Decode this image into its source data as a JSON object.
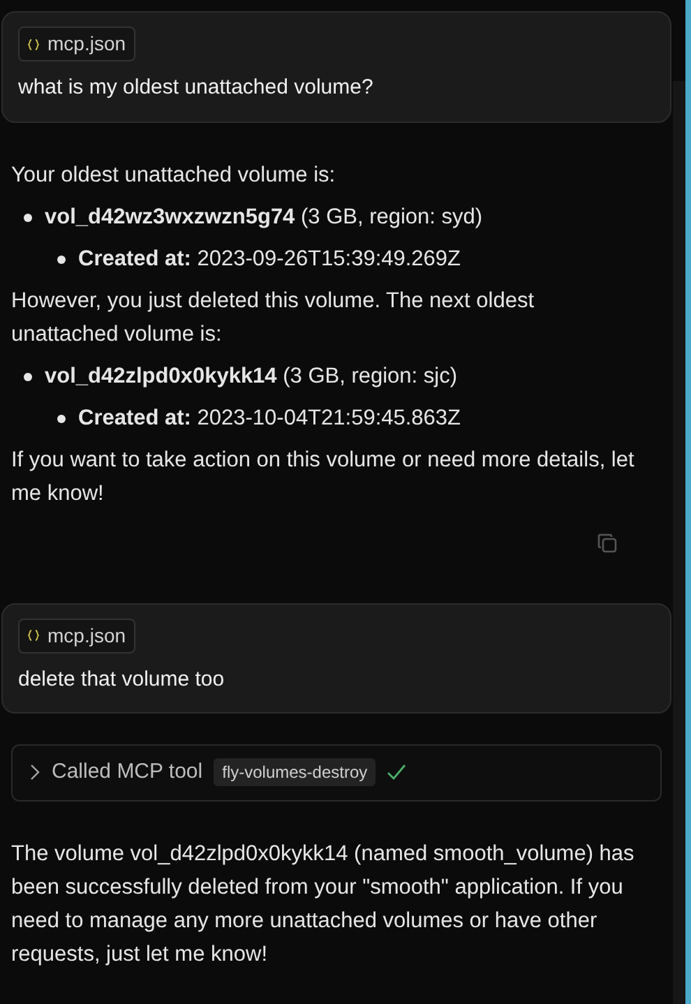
{
  "messages": [
    {
      "kind": "user",
      "attachment": "mcp.json",
      "text": "what is my oldest unattached volume?"
    },
    {
      "kind": "assistant",
      "copy": true,
      "blocks": [
        {
          "kind": "paragraph",
          "text": "Your oldest unattached volume is:"
        },
        {
          "kind": "bullet",
          "text": "**vol_d42wz3wxzwzn5g74** (3 GB, region: syd)",
          "children": [
            {
              "kind": "bullet",
              "text": "**Created at:** 2023-09-26T15:39:49.269Z"
            }
          ]
        },
        {
          "kind": "paragraph",
          "text": "However, you just deleted this volume. The next oldest unattached volume is:"
        },
        {
          "kind": "bullet",
          "text": "**vol_d42zlpd0x0kykk14** (3 GB, region: sjc)",
          "children": [
            {
              "kind": "bullet",
              "text": "**Created at:** 2023-10-04T21:59:45.863Z"
            }
          ]
        },
        {
          "kind": "paragraph",
          "text": "If you want to take action on this volume or need more details, let me know!"
        }
      ]
    },
    {
      "kind": "user",
      "attachment": "mcp.json",
      "text": "delete that volume too"
    },
    {
      "kind": "tool",
      "label": "Called MCP tool",
      "tool": "fly-volumes-destroy",
      "expanded": false,
      "done": true
    },
    {
      "kind": "assistant",
      "blocks": [
        {
          "kind": "paragraph",
          "text": "The volume vol_d42zlpd0x0kykk14 (named smooth_volume) has been successfully deleted from your \"smooth\" application. If you need to manage any more unattached volumes or have other requests, just let me know!"
        }
      ]
    }
  ]
}
